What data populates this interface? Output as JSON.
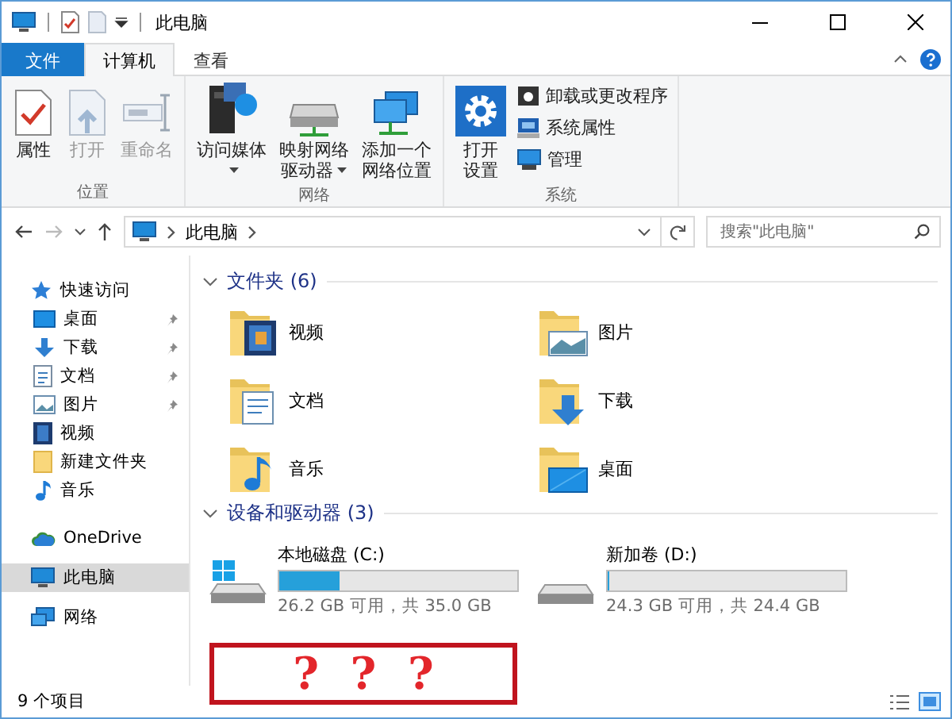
{
  "title_bar": {
    "title": "此电脑"
  },
  "ribbon_tabs": [
    {
      "label": "文件",
      "kind": "file",
      "selected": false
    },
    {
      "label": "计算机",
      "kind": "tab",
      "selected": true
    },
    {
      "label": "查看",
      "kind": "tab",
      "selected": false
    }
  ],
  "ribbon_groups": [
    {
      "label": "位置",
      "commands": [
        {
          "label": "属性",
          "kind": "large",
          "disabled": false,
          "dropdown": false
        },
        {
          "label": "打开",
          "kind": "large",
          "disabled": true,
          "dropdown": false
        },
        {
          "label": "重命名",
          "kind": "large",
          "disabled": true,
          "dropdown": false
        }
      ]
    },
    {
      "label": "网络",
      "commands": [
        {
          "label": "访问媒体",
          "kind": "large",
          "disabled": false,
          "dropdown": true
        },
        {
          "label": "映射网络驱动器",
          "kind": "large",
          "disabled": false,
          "dropdown": true
        },
        {
          "label": "添加一个网络位置",
          "kind": "large",
          "disabled": false,
          "dropdown": false
        }
      ]
    },
    {
      "label": "系统",
      "commands": [
        {
          "label": "打开设置",
          "kind": "large",
          "disabled": false,
          "dropdown": false
        },
        {
          "label": "卸载或更改程序",
          "kind": "small",
          "disabled": false,
          "dropdown": false
        },
        {
          "label": "系统属性",
          "kind": "small",
          "disabled": false,
          "dropdown": false
        },
        {
          "label": "管理",
          "kind": "small",
          "disabled": false,
          "dropdown": false
        }
      ]
    }
  ],
  "address_bar": {
    "path": [
      "此电脑"
    ]
  },
  "search": {
    "placeholder": "搜索\"此电脑\""
  },
  "sidebar": {
    "items": [
      {
        "label": "快速访问",
        "selected": false,
        "pinned": false,
        "children": [
          {
            "label": "桌面",
            "selected": false,
            "pinned": true
          },
          {
            "label": "下载",
            "selected": false,
            "pinned": true
          },
          {
            "label": "文档",
            "selected": false,
            "pinned": true
          },
          {
            "label": "图片",
            "selected": false,
            "pinned": true
          },
          {
            "label": "视频",
            "selected": false,
            "pinned": false
          },
          {
            "label": "新建文件夹",
            "selected": false,
            "pinned": false
          },
          {
            "label": "音乐",
            "selected": false,
            "pinned": false
          }
        ]
      },
      {
        "label": "OneDrive",
        "selected": false,
        "pinned": false
      },
      {
        "label": "此电脑",
        "selected": true,
        "pinned": false
      },
      {
        "label": "网络",
        "selected": false,
        "pinned": false
      }
    ]
  },
  "sections": [
    {
      "title": "文件夹 (6)",
      "expanded": true,
      "kind": "folders",
      "items": [
        {
          "label": "视频"
        },
        {
          "label": "图片"
        },
        {
          "label": "文档"
        },
        {
          "label": "下载"
        },
        {
          "label": "音乐"
        },
        {
          "label": "桌面"
        }
      ]
    },
    {
      "title": "设备和驱动器 (3)",
      "expanded": true,
      "kind": "drives",
      "items": [
        {
          "label": "本地磁盘 (C:)",
          "level": 0.25,
          "space": "26.2 GB 可用，共 35.0 GB"
        },
        {
          "label": "新加卷 (D:)",
          "level": 0.004,
          "space": "24.3 GB 可用，共 24.4 GB"
        }
      ]
    }
  ],
  "annotation": {
    "text": "? ? ?"
  },
  "status_bar": {
    "item_count": "9 个项目"
  }
}
